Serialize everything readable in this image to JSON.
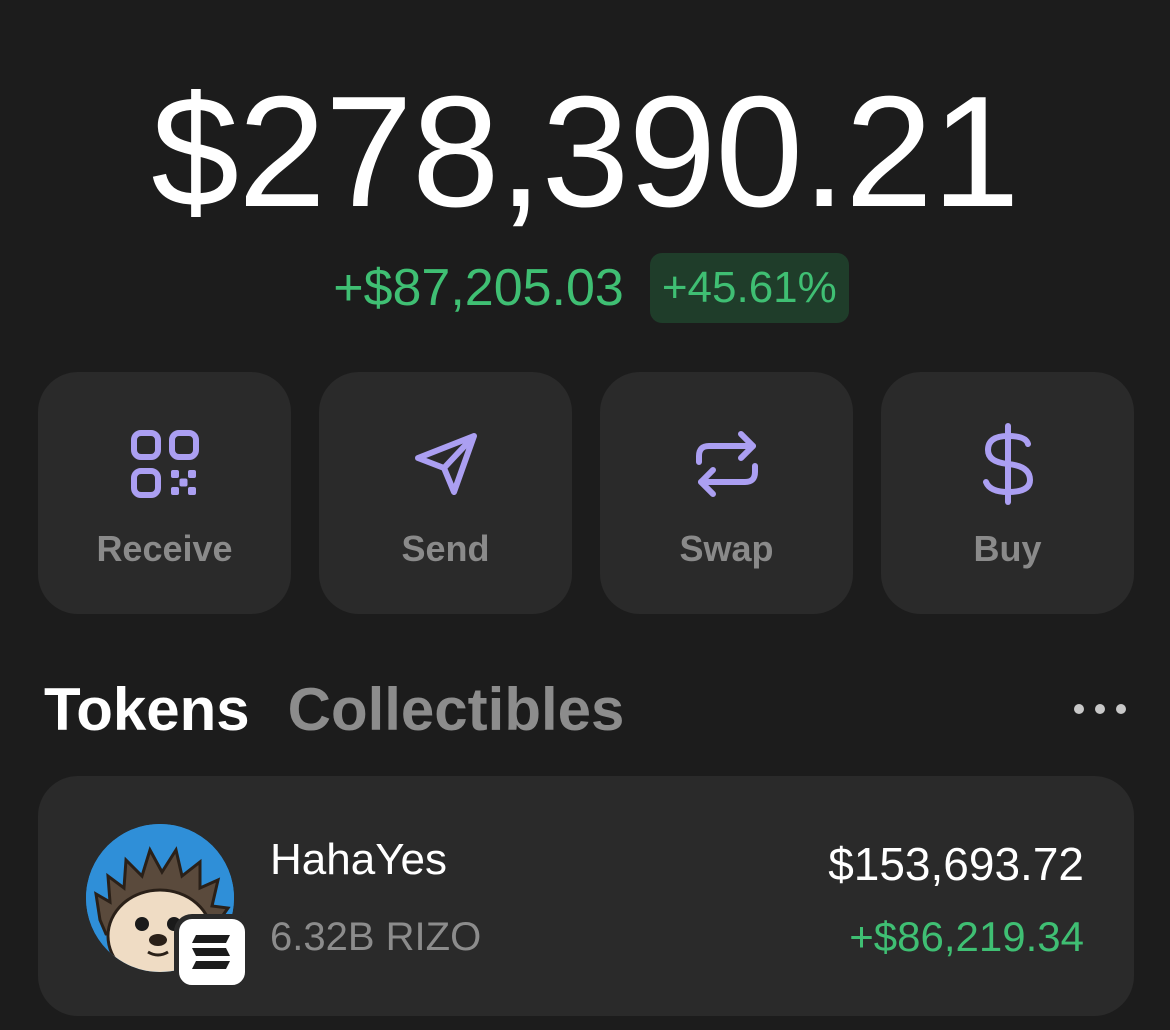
{
  "portfolio": {
    "balance": "$278,390.21",
    "change_amount": "+$87,205.03",
    "change_percent": "+45.61%"
  },
  "actions": [
    {
      "label": "Receive",
      "icon": "qr-code-icon"
    },
    {
      "label": "Send",
      "icon": "send-arrow-icon"
    },
    {
      "label": "Swap",
      "icon": "swap-arrows-icon"
    },
    {
      "label": "Buy",
      "icon": "dollar-icon"
    }
  ],
  "tabs": {
    "tokens": "Tokens",
    "collectibles": "Collectibles",
    "active": "Tokens"
  },
  "more_icon": "more-horizontal-icon",
  "tokens": [
    {
      "name": "HahaYes",
      "amount": "6.32B RIZO",
      "value": "$153,693.72",
      "change": "+$86,219.34",
      "avatar": "hedgehog-avatar",
      "chain_icon": "solana-icon"
    }
  ],
  "colors": {
    "background": "#1c1c1c",
    "card": "#2a2a2a",
    "accent": "#ab9ff2",
    "positive": "#3fbf73",
    "positive_badge_bg": "#1f3d2a",
    "muted_text": "#8c8c8c"
  }
}
